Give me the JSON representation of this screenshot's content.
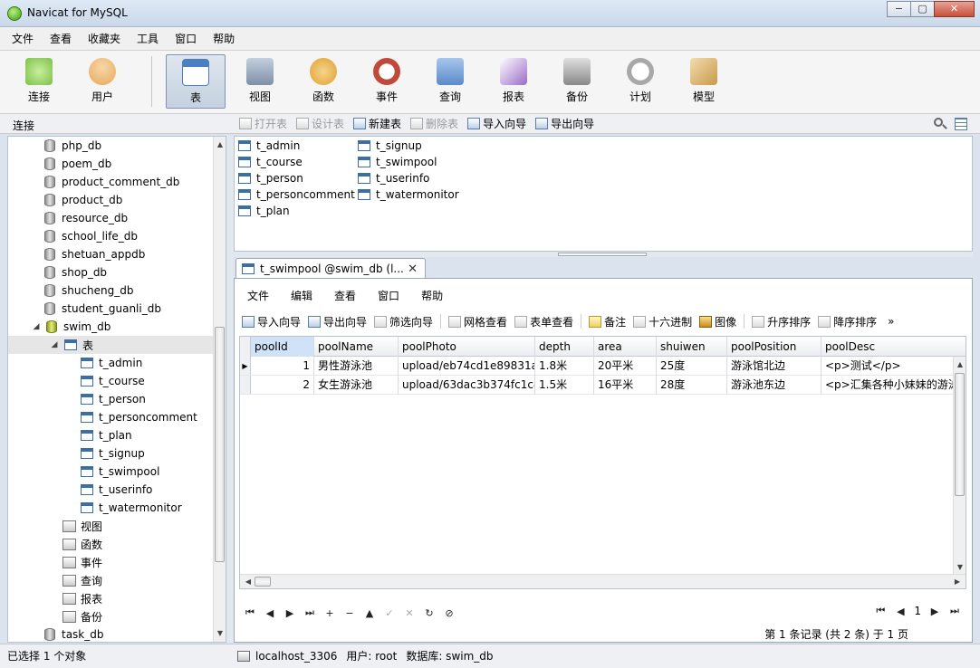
{
  "window": {
    "title": "Navicat for MySQL",
    "min_label": "−",
    "max_label": "▢",
    "close_label": "✕"
  },
  "menu": [
    "文件",
    "查看",
    "收藏夹",
    "工具",
    "窗口",
    "帮助"
  ],
  "toolbar": [
    {
      "label": "连接",
      "icon": "plug-icon",
      "color": "#7cc04a"
    },
    {
      "label": "用户",
      "icon": "user-icon",
      "color": "#e6a85a"
    },
    {
      "label": "表",
      "icon": "table-icon",
      "color": "#4a7fc1"
    },
    {
      "label": "视图",
      "icon": "view-icon",
      "color": "#7f8fa8"
    },
    {
      "label": "函数",
      "icon": "function-icon",
      "color": "#e0a030"
    },
    {
      "label": "事件",
      "icon": "event-icon",
      "color": "#c04a3a"
    },
    {
      "label": "查询",
      "icon": "query-icon",
      "color": "#5a8ac8"
    },
    {
      "label": "报表",
      "icon": "report-icon",
      "color": "#9a6ac8"
    },
    {
      "label": "备份",
      "icon": "backup-icon",
      "color": "#888888"
    },
    {
      "label": "计划",
      "icon": "schedule-icon",
      "color": "#a8a8a8"
    },
    {
      "label": "模型",
      "icon": "model-icon",
      "color": "#c89a4a"
    }
  ],
  "conn_header": "连接",
  "object_toolbar": [
    {
      "label": "打开表",
      "enabled": false
    },
    {
      "label": "设计表",
      "enabled": false
    },
    {
      "label": "新建表",
      "enabled": true
    },
    {
      "label": "删除表",
      "enabled": false
    },
    {
      "label": "导入向导",
      "enabled": true
    },
    {
      "label": "导出向导",
      "enabled": true
    }
  ],
  "tree": {
    "databases_above": [
      "php_db",
      "poem_db",
      "product_comment_db",
      "product_db",
      "resource_db",
      "school_life_db",
      "shetuan_appdb",
      "shop_db",
      "shucheng_db",
      "student_guanli_db"
    ],
    "open_db": "swim_db",
    "tables_node": "表",
    "tables": [
      "t_admin",
      "t_course",
      "t_person",
      "t_personcomment",
      "t_plan",
      "t_signup",
      "t_swimpool",
      "t_userinfo",
      "t_watermonitor"
    ],
    "other_nodes": [
      {
        "label": "视图",
        "icon": "view-icon"
      },
      {
        "label": "函数",
        "icon": "function-icon"
      },
      {
        "label": "事件",
        "icon": "event-icon"
      },
      {
        "label": "查询",
        "icon": "query-icon"
      },
      {
        "label": "报表",
        "icon": "report-icon"
      },
      {
        "label": "备份",
        "icon": "backup-icon"
      }
    ],
    "databases_below": [
      "task_db"
    ]
  },
  "object_list": [
    "t_admin",
    "t_course",
    "t_person",
    "t_personcomment",
    "t_plan",
    "t_signup",
    "t_swimpool",
    "t_userinfo",
    "t_watermonitor"
  ],
  "tab": {
    "label": "t_swimpool @swim_db (l...",
    "close": "✕"
  },
  "editor_menu": [
    "文件",
    "编辑",
    "查看",
    "窗口",
    "帮助"
  ],
  "editor_tools": [
    "导入向导",
    "导出向导",
    "筛选向导",
    "网格查看",
    "表单查看",
    "备注",
    "十六进制",
    "图像",
    "升序排序",
    "降序排序"
  ],
  "grid": {
    "columns": [
      "poolId",
      "poolName",
      "poolPhoto",
      "depth",
      "area",
      "shuiwen",
      "poolPosition",
      "poolDesc"
    ],
    "rows": [
      [
        "1",
        "男性游泳池",
        "upload/eb74cd1e89831a",
        "1.8米",
        "20平米",
        "25度",
        "游泳馆北边",
        "<p>测试</p>"
      ],
      [
        "2",
        "女生游泳池",
        "upload/63dac3b374fc1c4",
        "1.5米",
        "16平米",
        "28度",
        "游泳池东边",
        "<p>汇集各种小妹妹的游泳"
      ]
    ]
  },
  "nav": {
    "first": "⏮",
    "prev": "◀",
    "next": "▶",
    "last": "⏭",
    "add": "+",
    "delete": "−",
    "up": "▲",
    "apply": "✓",
    "cancel": "✕",
    "refresh": "↻",
    "stop": "⊘",
    "page_first": "⏮",
    "page_prev": "◀",
    "page": "1",
    "page_next": "▶",
    "page_last": "⏭"
  },
  "record_info": "第 1 条记录 (共 2 条) 于 1 页",
  "status": {
    "left": "已选择 1 个对象",
    "host": "localhost_3306",
    "user": "用户: root",
    "db": "数据库: swim_db"
  }
}
